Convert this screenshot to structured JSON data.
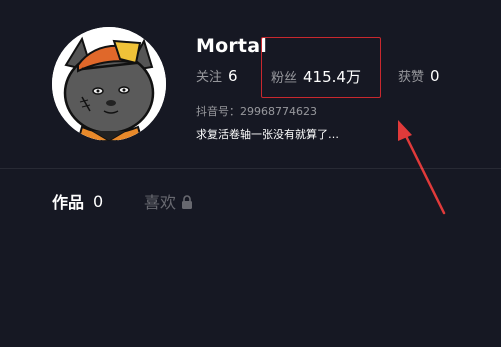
{
  "profile": {
    "name": "Mortal",
    "account_id": "抖音号：29968774623",
    "bio": "求复活卷轴一张没有就算了…",
    "avatar_icon": "cartoon-cat-avatar"
  },
  "stats": {
    "following_label": "关注",
    "following_value": "6",
    "followers_label": "粉丝",
    "followers_value": "415.4万",
    "likes_label": "获赞",
    "likes_value": "0"
  },
  "tabs": {
    "works_label": "作品",
    "works_count": "0",
    "likes_label": "喜欢",
    "likes_icon": "lock-icon"
  },
  "annotation": {
    "highlight_color": "#c8282e",
    "arrow_color": "#e03a3a"
  }
}
